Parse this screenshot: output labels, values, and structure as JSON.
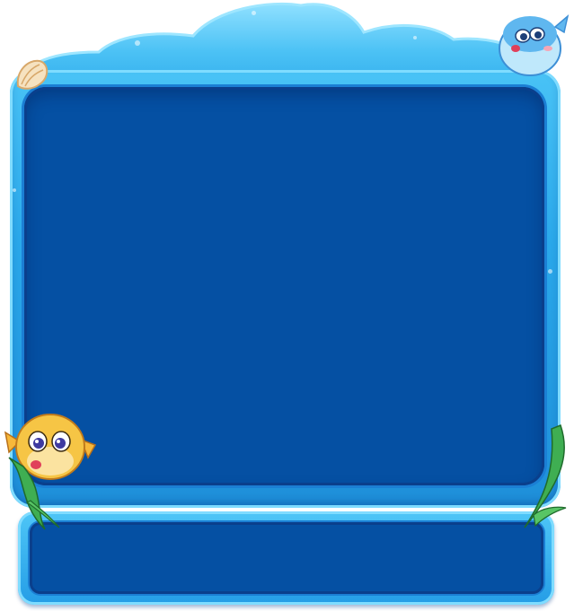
{
  "frame": {
    "colors": {
      "screen": "#0550a3",
      "frame_light": "#49c3f6",
      "frame_dark": "#1e8fd9",
      "rim": "#7fdcff"
    }
  },
  "decorations": {
    "top_right": "blue-pufferfish-icon",
    "top_left": "seashell-icon",
    "bottom_left": "yellow-pufferfish-icon",
    "seaweed": "seaweed-icon"
  }
}
